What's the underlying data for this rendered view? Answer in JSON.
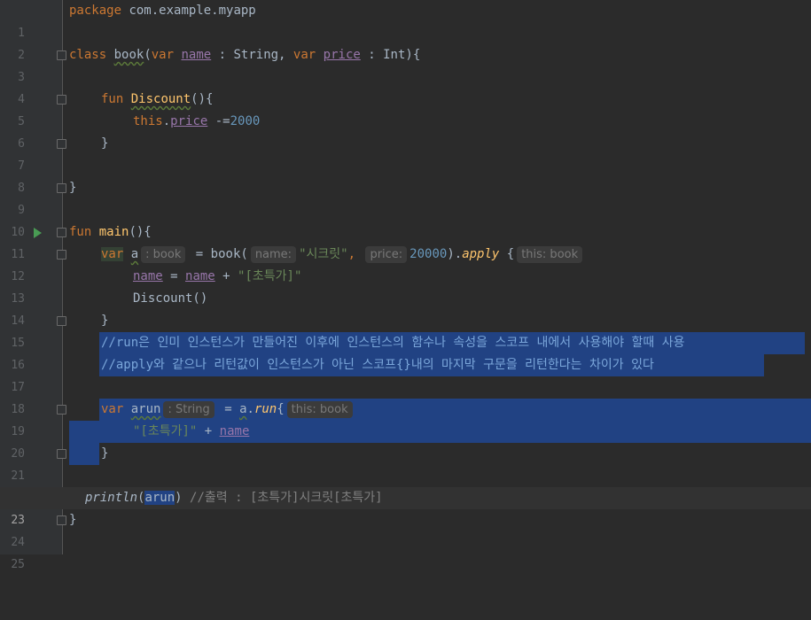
{
  "editor": {
    "line_numbers": [
      "1",
      "2",
      "3",
      "4",
      "5",
      "6",
      "7",
      "8",
      "9",
      "10",
      "11",
      "12",
      "13",
      "14",
      "15",
      "16",
      "17",
      "18",
      "19",
      "20",
      "21",
      "22",
      "23",
      "24",
      "25"
    ],
    "l1": {
      "kw": "package",
      "rest": " com.example.myapp"
    },
    "l3": {
      "kw_class": "class",
      "name": "book",
      "p1": "(",
      "kw_var": "var",
      "pname": "name",
      "colon1": " : String, ",
      "kw_var2": "var",
      "pprice": "price",
      "colon2": " : Int){"
    },
    "l5": {
      "kw": "fun",
      "fn": "Discount",
      "rest": "(){"
    },
    "l6": {
      "kw": "this",
      "dot": ".",
      "prop": "price",
      "op": " -=",
      "num": "2000"
    },
    "l7": {
      "brace": "}"
    },
    "l9": {
      "brace": "}"
    },
    "l11": {
      "kw": "fun",
      "fn": "main",
      "rest": "(){"
    },
    "l12": {
      "kw": "var",
      "name": "a",
      "hint_type": ": book",
      "eq": " = book(",
      "hint_name": "name:",
      "str": "\"시크릿\"",
      "comma": ",",
      "hint_price": "price:",
      "num": "20000",
      "close": ").",
      "apply": "apply",
      "brace": " {",
      "hint_this": "this: book"
    },
    "l13": {
      "prop1": "name",
      "eq": " = ",
      "prop2": "name",
      "plus": " + ",
      "str": "\"[초특가]\""
    },
    "l14": {
      "call": "Discount()"
    },
    "l15": {
      "brace": "}"
    },
    "l16": {
      "comment": "//run은 인미 인스턴스가 만들어진 이후에 인스턴스의 함수나 속성을 스코프 내에서 사용해야 할때 사용"
    },
    "l17": {
      "comment": "//apply와 같으나 리턴값이 인스턴스가 아닌 스코프{}내의 마지막 구문을 리턴한다는 차이가 있다"
    },
    "l19": {
      "kw": "var",
      "name": "arun",
      "hint_type": ": String",
      "eq": " = ",
      "recv": "a",
      "dot": ".",
      "run": "run",
      "brace": "{",
      "hint_this": "this: book"
    },
    "l20": {
      "str": "\"[초특가]\"",
      "plus": " + ",
      "prop": "name"
    },
    "l21": {
      "brace": "}"
    },
    "l23": {
      "println": "println",
      "open": "(",
      "arg": "arun",
      "close": ")",
      "comment": " //출력 : [초특가]시크릿[초특가]"
    },
    "l24": {
      "brace": "}"
    }
  }
}
